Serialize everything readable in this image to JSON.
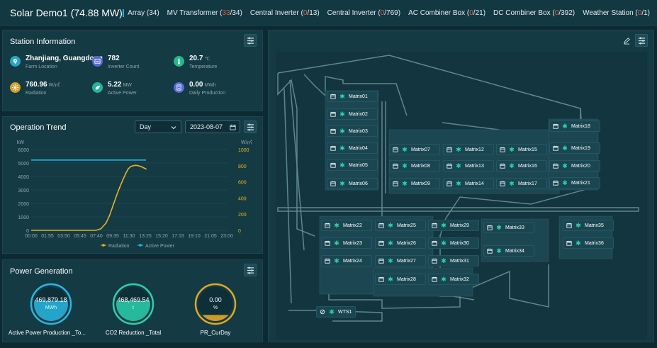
{
  "header": {
    "title": "Solar Demo1",
    "capacity": "(74.88 MW)",
    "stats": [
      {
        "label": "Array",
        "text": "(34)",
        "pre": "(",
        "alarm": "",
        "post": "34)"
      },
      {
        "label": "MV Transformer",
        "pre": "(",
        "alarm": "33",
        "post": "/34)"
      },
      {
        "label": "Central Inverter",
        "pre": "(",
        "alarm": "0",
        "post": "/13)"
      },
      {
        "label": "Central Inverter",
        "pre": "(",
        "alarm": "0",
        "post": "/769)"
      },
      {
        "label": "AC Combiner Box",
        "pre": "(",
        "alarm": "0",
        "post": "/21)"
      },
      {
        "label": "DC Combiner Box",
        "pre": "(",
        "alarm": "0",
        "post": "/392)"
      },
      {
        "label": "Weather Station",
        "pre": "(",
        "alarm": "0",
        "post": "/1)"
      }
    ]
  },
  "station": {
    "title": "Station Information",
    "items": [
      {
        "value": "Zhanjiang, Guangdong",
        "unit": "",
        "label": "Farm Location",
        "icon": "location-pin-icon",
        "color": "#1fa8c9"
      },
      {
        "value": "782",
        "unit": "",
        "label": "Inverter Count",
        "icon": "inverter-icon",
        "color": "#5a6ad8"
      },
      {
        "value": "20.7",
        "unit": "℃",
        "label": "Temperature",
        "icon": "thermometer-icon",
        "color": "#25b98a"
      },
      {
        "value": "760.96",
        "unit": "W/㎡",
        "label": "Radiation",
        "icon": "sun-icon",
        "color": "#d6a02a"
      },
      {
        "value": "5.22",
        "unit": "MW",
        "label": "Active Power",
        "icon": "power-leaf-icon",
        "color": "#22b59a"
      },
      {
        "value": "0.00",
        "unit": "MWh",
        "label": "Daily Production",
        "icon": "document-icon",
        "color": "#5a6ad8"
      }
    ]
  },
  "trend": {
    "title": "Operation Trend",
    "period": "Day",
    "date": "2023-08-07"
  },
  "chart_data": {
    "type": "line",
    "title": "Operation Trend",
    "x": [
      "00:00",
      "01:55",
      "03:50",
      "05:45",
      "07:40",
      "09:35",
      "11:30",
      "13:25",
      "15:20",
      "17:15",
      "19:10",
      "21:05",
      "23:00"
    ],
    "y_left_label": "kW",
    "y_right_label": "W/㎡",
    "ylim_left": [
      0,
      6000
    ],
    "ylim_right": [
      0,
      1000
    ],
    "left_ticks": [
      "6000",
      "5000",
      "4000",
      "3000",
      "2000",
      "1000",
      "0"
    ],
    "right_ticks": [
      "1000",
      "800",
      "600",
      "400",
      "200",
      "0"
    ],
    "legend": [
      "Radiation",
      "Active Power"
    ],
    "legend_position": "bottom-center",
    "colors": {
      "Radiation": "#e8b21c",
      "Active Power": "#25b8e6"
    },
    "series": [
      {
        "name": "Radiation",
        "axis": "right",
        "points": [
          [
            0,
            0
          ],
          [
            7.6,
            0
          ],
          [
            8.2,
            20
          ],
          [
            8.8,
            90
          ],
          [
            9.2,
            180
          ],
          [
            9.6,
            300
          ],
          [
            10.0,
            420
          ],
          [
            10.4,
            530
          ],
          [
            10.8,
            630
          ],
          [
            11.1,
            700
          ],
          [
            11.4,
            760
          ],
          [
            11.7,
            790
          ],
          [
            12.0,
            800
          ],
          [
            12.3,
            805
          ],
          [
            12.6,
            800
          ],
          [
            12.9,
            790
          ],
          [
            13.2,
            775
          ],
          [
            13.5,
            760
          ]
        ]
      },
      {
        "name": "Active Power",
        "axis": "left",
        "points": [
          [
            0,
            5220
          ],
          [
            13.5,
            5220
          ]
        ]
      }
    ]
  },
  "generation": {
    "title": "Power Generation",
    "gauges": [
      {
        "value": "469,879.18",
        "unit": "MWh",
        "label": "Active Power Production _To...",
        "color": "#27b8e3",
        "level": 0.6
      },
      {
        "value": "468,469.54",
        "unit": "t",
        "label": "CO2 Reduction _Total",
        "color": "#2ad1ad",
        "level": 0.6
      },
      {
        "value": "0.00",
        "unit": "%",
        "label": "PR_CurDay",
        "color": "#e0a826",
        "level": 0.0
      }
    ]
  },
  "map": {
    "matrices": [
      "Matrix01",
      "Matrix02",
      "Matrix03",
      "Matrix04",
      "Matrix05",
      "Matrix06",
      "Matrix07",
      "Matrix08",
      "Matrix09",
      "Matrix12",
      "Matrix13",
      "Matrix14",
      "Matrix15",
      "Matrix16",
      "Matrix17",
      "Matrix18",
      "Matrix19",
      "Matrix20",
      "Matrix21",
      "Matrix22",
      "Matrix23",
      "Matrix24",
      "Matrix25",
      "Matrix26",
      "Matrix27",
      "Matrix28",
      "Matrix29",
      "Matrix30",
      "Matrix31",
      "Matrix32",
      "Matrix33",
      "Matrix34",
      "Matrix35",
      "Matrix36"
    ],
    "weather_station": "WTS1"
  }
}
